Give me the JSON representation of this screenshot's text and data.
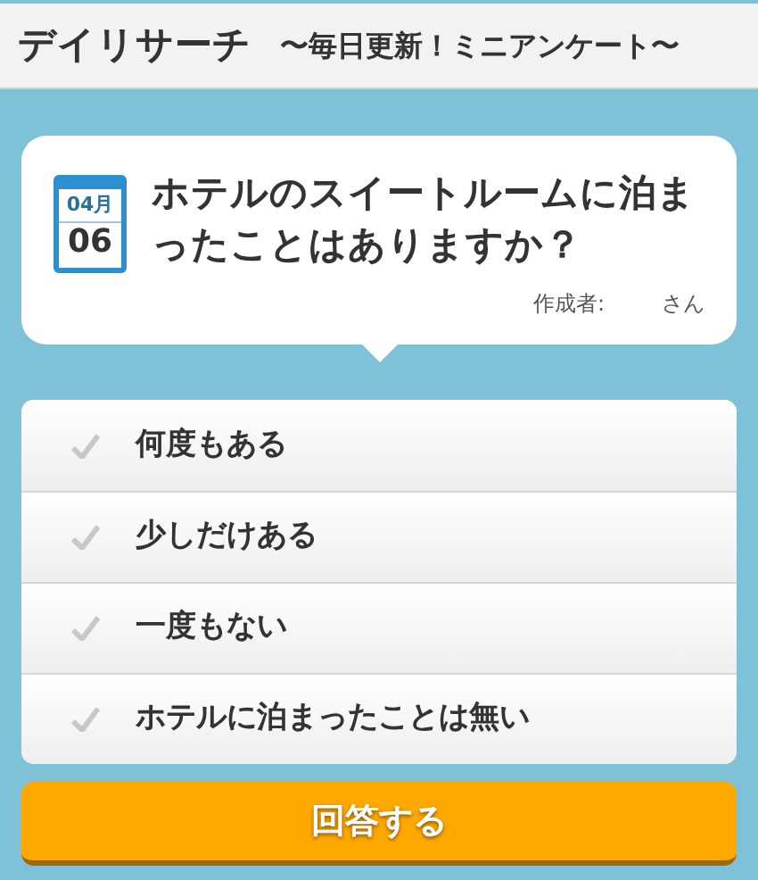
{
  "header": {
    "title": "デイリサーチ",
    "subtitle": "〜毎日更新！ミニアンケート〜"
  },
  "question": {
    "month": "04月",
    "day": "06",
    "text": "ホテルのスイートルームに泊まったことはありますか？",
    "author_label": "作成者:",
    "author": "さん"
  },
  "options": [
    {
      "label": "何度もある",
      "selected": false
    },
    {
      "label": "少しだけある",
      "selected": false
    },
    {
      "label": "一度もない",
      "selected": false
    },
    {
      "label": "ホテルに泊まったことは無い",
      "selected": false
    }
  ],
  "submit": "回答する"
}
